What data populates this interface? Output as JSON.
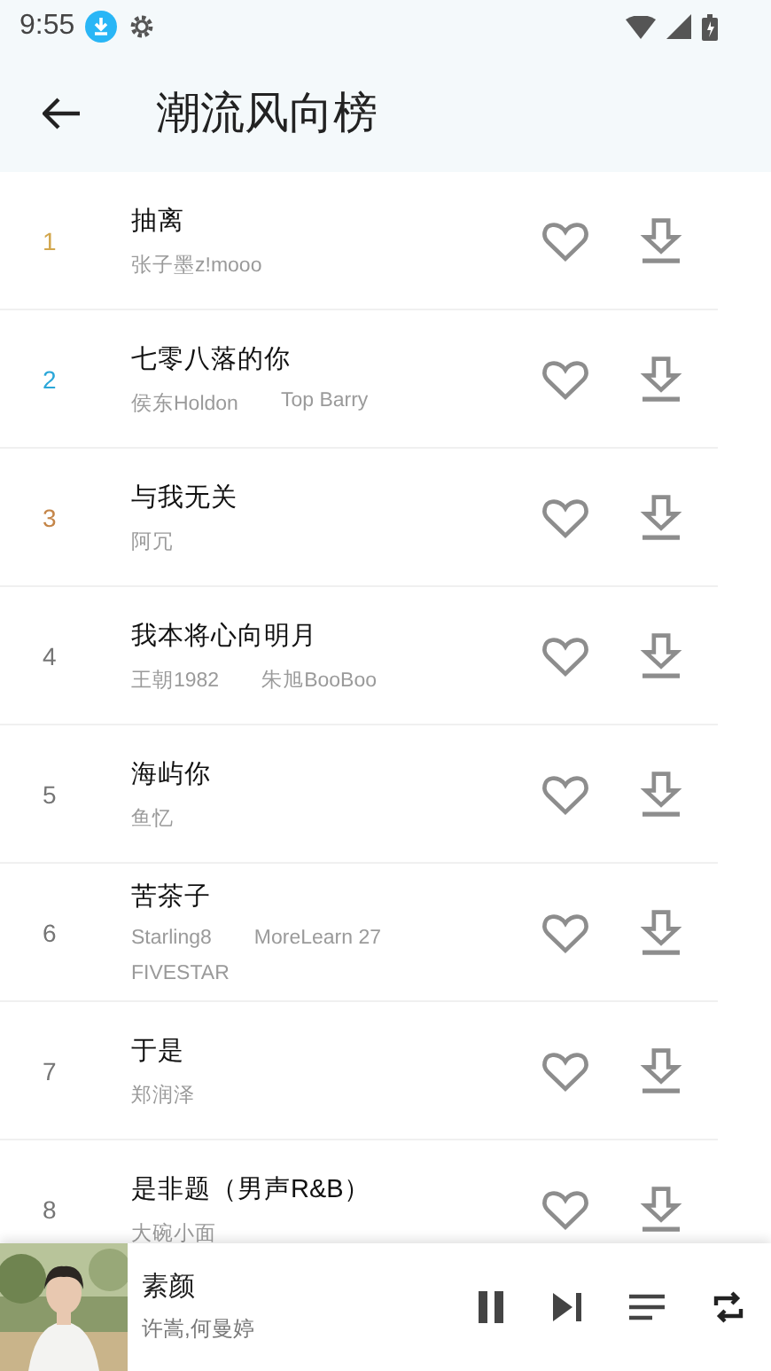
{
  "status_bar": {
    "time": "9:55"
  },
  "header": {
    "title": "潮流风向榜"
  },
  "songs": [
    {
      "rank": "1",
      "color": "#d2a64c",
      "title": "抽离",
      "artists": [
        "张子墨z!mooo"
      ]
    },
    {
      "rank": "2",
      "color": "#2ba7d9",
      "title": "七零八落的你",
      "artists": [
        "侯东Holdon",
        "Top Barry"
      ]
    },
    {
      "rank": "3",
      "color": "#c48548",
      "title": "与我无关",
      "artists": [
        "阿冗"
      ]
    },
    {
      "rank": "4",
      "color": "#757575",
      "title": "我本将心向明月",
      "artists": [
        "王朝1982",
        "朱旭BooBoo"
      ]
    },
    {
      "rank": "5",
      "color": "#757575",
      "title": "海屿你",
      "artists": [
        "鱼忆"
      ]
    },
    {
      "rank": "6",
      "color": "#757575",
      "title": "苦茶子",
      "artists": [
        "Starling8",
        "MoreLearn 27",
        "FIVESTAR"
      ]
    },
    {
      "rank": "7",
      "color": "#757575",
      "title": "于是",
      "artists": [
        "郑润泽"
      ]
    },
    {
      "rank": "8",
      "color": "#757575",
      "title": "是非题（男声R&B）",
      "artists": [
        "大碗小面"
      ]
    }
  ],
  "player": {
    "title": "素颜",
    "artist": "许嵩,何曼婷"
  }
}
